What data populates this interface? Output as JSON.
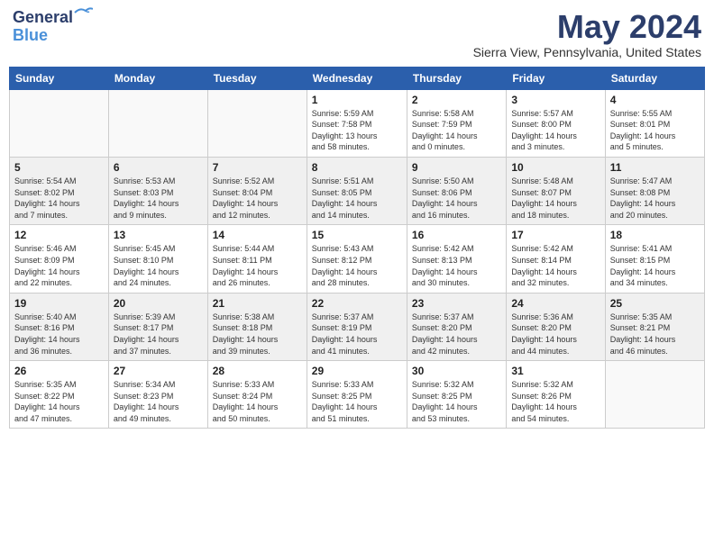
{
  "header": {
    "logo_line1": "General",
    "logo_line2": "Blue",
    "month": "May 2024",
    "location": "Sierra View, Pennsylvania, United States"
  },
  "days_of_week": [
    "Sunday",
    "Monday",
    "Tuesday",
    "Wednesday",
    "Thursday",
    "Friday",
    "Saturday"
  ],
  "weeks": [
    [
      {
        "day": "",
        "content": ""
      },
      {
        "day": "",
        "content": ""
      },
      {
        "day": "",
        "content": ""
      },
      {
        "day": "1",
        "content": "Sunrise: 5:59 AM\nSunset: 7:58 PM\nDaylight: 13 hours\nand 58 minutes."
      },
      {
        "day": "2",
        "content": "Sunrise: 5:58 AM\nSunset: 7:59 PM\nDaylight: 14 hours\nand 0 minutes."
      },
      {
        "day": "3",
        "content": "Sunrise: 5:57 AM\nSunset: 8:00 PM\nDaylight: 14 hours\nand 3 minutes."
      },
      {
        "day": "4",
        "content": "Sunrise: 5:55 AM\nSunset: 8:01 PM\nDaylight: 14 hours\nand 5 minutes."
      }
    ],
    [
      {
        "day": "5",
        "content": "Sunrise: 5:54 AM\nSunset: 8:02 PM\nDaylight: 14 hours\nand 7 minutes."
      },
      {
        "day": "6",
        "content": "Sunrise: 5:53 AM\nSunset: 8:03 PM\nDaylight: 14 hours\nand 9 minutes."
      },
      {
        "day": "7",
        "content": "Sunrise: 5:52 AM\nSunset: 8:04 PM\nDaylight: 14 hours\nand 12 minutes."
      },
      {
        "day": "8",
        "content": "Sunrise: 5:51 AM\nSunset: 8:05 PM\nDaylight: 14 hours\nand 14 minutes."
      },
      {
        "day": "9",
        "content": "Sunrise: 5:50 AM\nSunset: 8:06 PM\nDaylight: 14 hours\nand 16 minutes."
      },
      {
        "day": "10",
        "content": "Sunrise: 5:48 AM\nSunset: 8:07 PM\nDaylight: 14 hours\nand 18 minutes."
      },
      {
        "day": "11",
        "content": "Sunrise: 5:47 AM\nSunset: 8:08 PM\nDaylight: 14 hours\nand 20 minutes."
      }
    ],
    [
      {
        "day": "12",
        "content": "Sunrise: 5:46 AM\nSunset: 8:09 PM\nDaylight: 14 hours\nand 22 minutes."
      },
      {
        "day": "13",
        "content": "Sunrise: 5:45 AM\nSunset: 8:10 PM\nDaylight: 14 hours\nand 24 minutes."
      },
      {
        "day": "14",
        "content": "Sunrise: 5:44 AM\nSunset: 8:11 PM\nDaylight: 14 hours\nand 26 minutes."
      },
      {
        "day": "15",
        "content": "Sunrise: 5:43 AM\nSunset: 8:12 PM\nDaylight: 14 hours\nand 28 minutes."
      },
      {
        "day": "16",
        "content": "Sunrise: 5:42 AM\nSunset: 8:13 PM\nDaylight: 14 hours\nand 30 minutes."
      },
      {
        "day": "17",
        "content": "Sunrise: 5:42 AM\nSunset: 8:14 PM\nDaylight: 14 hours\nand 32 minutes."
      },
      {
        "day": "18",
        "content": "Sunrise: 5:41 AM\nSunset: 8:15 PM\nDaylight: 14 hours\nand 34 minutes."
      }
    ],
    [
      {
        "day": "19",
        "content": "Sunrise: 5:40 AM\nSunset: 8:16 PM\nDaylight: 14 hours\nand 36 minutes."
      },
      {
        "day": "20",
        "content": "Sunrise: 5:39 AM\nSunset: 8:17 PM\nDaylight: 14 hours\nand 37 minutes."
      },
      {
        "day": "21",
        "content": "Sunrise: 5:38 AM\nSunset: 8:18 PM\nDaylight: 14 hours\nand 39 minutes."
      },
      {
        "day": "22",
        "content": "Sunrise: 5:37 AM\nSunset: 8:19 PM\nDaylight: 14 hours\nand 41 minutes."
      },
      {
        "day": "23",
        "content": "Sunrise: 5:37 AM\nSunset: 8:20 PM\nDaylight: 14 hours\nand 42 minutes."
      },
      {
        "day": "24",
        "content": "Sunrise: 5:36 AM\nSunset: 8:20 PM\nDaylight: 14 hours\nand 44 minutes."
      },
      {
        "day": "25",
        "content": "Sunrise: 5:35 AM\nSunset: 8:21 PM\nDaylight: 14 hours\nand 46 minutes."
      }
    ],
    [
      {
        "day": "26",
        "content": "Sunrise: 5:35 AM\nSunset: 8:22 PM\nDaylight: 14 hours\nand 47 minutes."
      },
      {
        "day": "27",
        "content": "Sunrise: 5:34 AM\nSunset: 8:23 PM\nDaylight: 14 hours\nand 49 minutes."
      },
      {
        "day": "28",
        "content": "Sunrise: 5:33 AM\nSunset: 8:24 PM\nDaylight: 14 hours\nand 50 minutes."
      },
      {
        "day": "29",
        "content": "Sunrise: 5:33 AM\nSunset: 8:25 PM\nDaylight: 14 hours\nand 51 minutes."
      },
      {
        "day": "30",
        "content": "Sunrise: 5:32 AM\nSunset: 8:25 PM\nDaylight: 14 hours\nand 53 minutes."
      },
      {
        "day": "31",
        "content": "Sunrise: 5:32 AM\nSunset: 8:26 PM\nDaylight: 14 hours\nand 54 minutes."
      },
      {
        "day": "",
        "content": ""
      }
    ]
  ]
}
